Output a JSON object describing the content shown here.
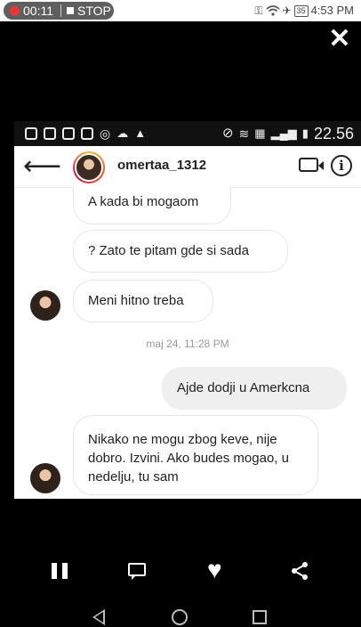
{
  "device_status": {
    "recording_time": "00:11",
    "stop_label": "STOP",
    "battery": "35",
    "time": "4:53 PM"
  },
  "inner_status": {
    "time": "22.56"
  },
  "chat": {
    "username": "omertaa_1312",
    "messages": [
      {
        "text": "A kada bi mogaom",
        "direction": "incoming"
      },
      {
        "text": "? Zato te pitam gde si sada",
        "direction": "incoming"
      },
      {
        "text": "Meni hitno treba",
        "direction": "incoming"
      },
      {
        "text": "Ajde dodji u Amerkcna",
        "direction": "outgoing"
      },
      {
        "text": "Nikako ne mogu zbog keve, nije dobro. Izvini. Ako budes mogao, u nedelju, tu sam",
        "direction": "incoming"
      }
    ],
    "timestamp": "maj 24, 11:28 PM"
  },
  "colors": {
    "recording_dot": "#e53935",
    "outgoing_bubble": "#efefef",
    "timestamp_text": "#999999"
  },
  "icons": [
    "key-icon",
    "wifi-icon",
    "airplane-icon",
    "close-icon",
    "back-arrow-icon",
    "video-call-icon",
    "info-icon",
    "pause-icon",
    "chat-icon",
    "heart-icon",
    "share-icon",
    "nav-back-icon",
    "nav-home-icon",
    "nav-recents-icon"
  ]
}
